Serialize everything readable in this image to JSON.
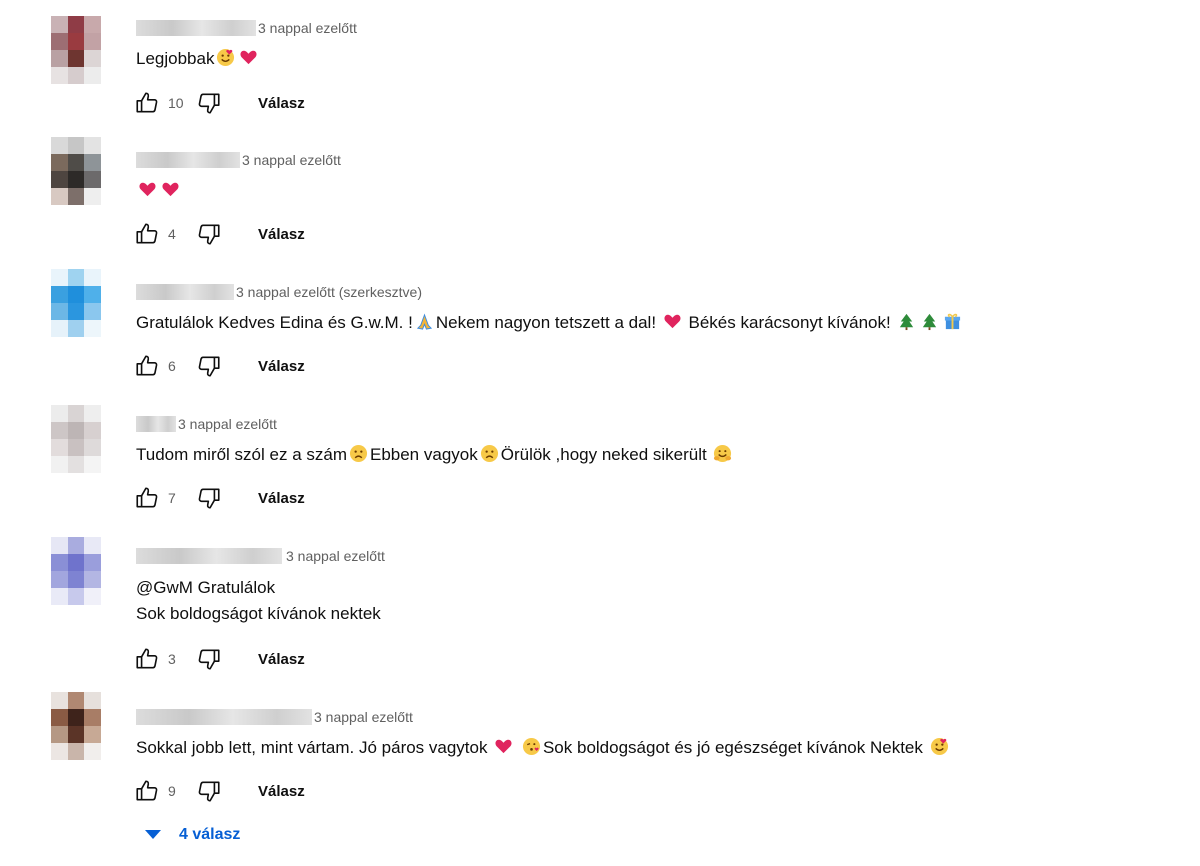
{
  "comments": [
    {
      "timestamp": "3 nappal ezelőtt",
      "text": "Legjobbak",
      "likes": "10",
      "reply_label": "Válasz",
      "avatar_colors": [
        "#c9b2b5",
        "#8f3c46",
        "#c8a9ab",
        "#9d6e73",
        "#9a3b40",
        "#c2a2a5",
        "#b9a1a3",
        "#6e3530",
        "#dcd5d5",
        "#e7e2e2",
        "#d6cccd",
        "#ececec"
      ]
    },
    {
      "timestamp": "3 nappal ezelőtt",
      "text": "",
      "likes": "4",
      "reply_label": "Válasz",
      "avatar_colors": [
        "#d9d9d9",
        "#c6c6c6",
        "#e3e3e3",
        "#7b6a5d",
        "#4f4c48",
        "#8e9498",
        "#4e4540",
        "#2d2a28",
        "#6c6a6b",
        "#d8c9c2",
        "#7d6f6a",
        "#eeeeee"
      ]
    },
    {
      "timestamp": "3 nappal ezelőtt (szerkesztve)",
      "text_parts": [
        "Gratulálok Kedves Edina és G.w.M. !",
        "Nekem nagyon tetszett a dal!",
        "Békés karácsonyt kívánok!"
      ],
      "likes": "6",
      "reply_label": "Válasz",
      "avatar_colors": [
        "#e9f4fb",
        "#9fd3f0",
        "#e9f4fb",
        "#3aa0e0",
        "#1f8fdc",
        "#4fb0ea",
        "#6cb7e6",
        "#2b96df",
        "#8bc7ee",
        "#e6f2fa",
        "#9fd0ef",
        "#edf6fb"
      ]
    },
    {
      "timestamp": "3 nappal ezelőtt",
      "text_parts": [
        "Tudom miről szól ez a szám",
        "Ebben vagyok",
        "Örülök ,hogy neked sikerült"
      ],
      "likes": "7",
      "reply_label": "Válasz",
      "avatar_colors": [
        "#ececec",
        "#d9d4d4",
        "#eeeeee",
        "#cdc6c6",
        "#bdb5b5",
        "#d7d0d0",
        "#e2dcdc",
        "#c9c1c1",
        "#dedada",
        "#f1f1f1",
        "#e3e0e0",
        "#f4f4f4"
      ]
    },
    {
      "timestamp": "3 nappal ezelőtt",
      "text_lines": [
        "@GwM Gratulálok",
        "Sok boldogságot kívánok nektek"
      ],
      "likes": "3",
      "reply_label": "Válasz",
      "avatar_colors": [
        "#e6e7f5",
        "#a9acdf",
        "#e8e9f6",
        "#8a8fd6",
        "#6f73cc",
        "#9a9edc",
        "#a2a6de",
        "#7e83d2",
        "#b3b6e3",
        "#e9eaf7",
        "#c7c9ec",
        "#f0f0f9"
      ]
    },
    {
      "timestamp": "3 nappal ezelőtt",
      "text_parts": [
        "Sokkal jobb lett, mint vártam. Jó páros vagytok",
        "Sok boldogságot és jó egészséget kívánok Nektek"
      ],
      "likes": "9",
      "reply_label": "Válasz",
      "avatar_colors": [
        "#e8e2de",
        "#b08872",
        "#e6e0dc",
        "#8a5b44",
        "#3e231b",
        "#a87d66",
        "#b59884",
        "#5b3427",
        "#c7a995",
        "#ece6e3",
        "#c9b5aa",
        "#f1eeec"
      ]
    }
  ],
  "replies_toggle": "4 válasz",
  "colors": {
    "heart": "#e0245e",
    "link": "#065fd4",
    "muted": "#606060"
  }
}
